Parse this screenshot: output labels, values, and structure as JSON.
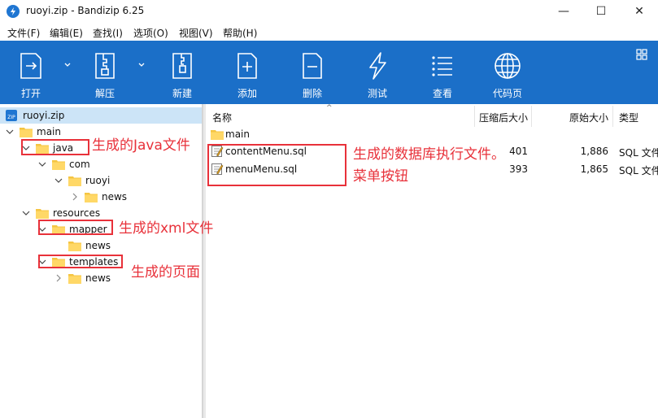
{
  "window": {
    "title": "ruoyi.zip - Bandizip 6.25",
    "minimize": "—",
    "maximize": "☐",
    "close": "✕"
  },
  "menu": [
    "文件(F)",
    "编辑(E)",
    "查找(I)",
    "选项(O)",
    "视图(V)",
    "帮助(H)"
  ],
  "toolbar": {
    "buttons": [
      {
        "label": "打开",
        "icon": "open-icon"
      },
      {
        "label": "解压",
        "icon": "extract-icon"
      },
      {
        "label": "新建",
        "icon": "new-archive-icon"
      },
      {
        "label": "添加",
        "icon": "add-file-icon"
      },
      {
        "label": "删除",
        "icon": "delete-file-icon"
      },
      {
        "label": "测试",
        "icon": "test-icon"
      },
      {
        "label": "查看",
        "icon": "view-icon"
      },
      {
        "label": "代码页",
        "icon": "codepage-globe-icon"
      }
    ],
    "color": "#1b6fc8"
  },
  "tree": {
    "root": "ruoyi.zip",
    "nodes": [
      {
        "label": "main"
      },
      {
        "label": "java"
      },
      {
        "label": "com"
      },
      {
        "label": "ruoyi"
      },
      {
        "label": "news"
      },
      {
        "label": "resources"
      },
      {
        "label": "mapper"
      },
      {
        "label": "news"
      },
      {
        "label": "templates"
      },
      {
        "label": "news"
      }
    ]
  },
  "list": {
    "columns": {
      "name": "名称",
      "compressed": "压缩后大小",
      "original": "原始大小",
      "type": "类型"
    },
    "rows": [
      {
        "name": "main",
        "compressed": "",
        "original": "",
        "type": "",
        "icon": "folder-icon"
      },
      {
        "name": "contentMenu.sql",
        "compressed": "401",
        "original": "1,886",
        "type": "SQL 文件",
        "icon": "sql-file-icon"
      },
      {
        "name": "menuMenu.sql",
        "compressed": "393",
        "original": "1,865",
        "type": "SQL 文件",
        "icon": "sql-file-icon"
      }
    ]
  },
  "annotations": {
    "java": "生成的Java文件",
    "sql_line1": "生成的数据库执行文件。",
    "sql_line2": "菜单按钮",
    "xml": "生成的xml文件",
    "pages": "生成的页面",
    "color": "#e8313a"
  }
}
